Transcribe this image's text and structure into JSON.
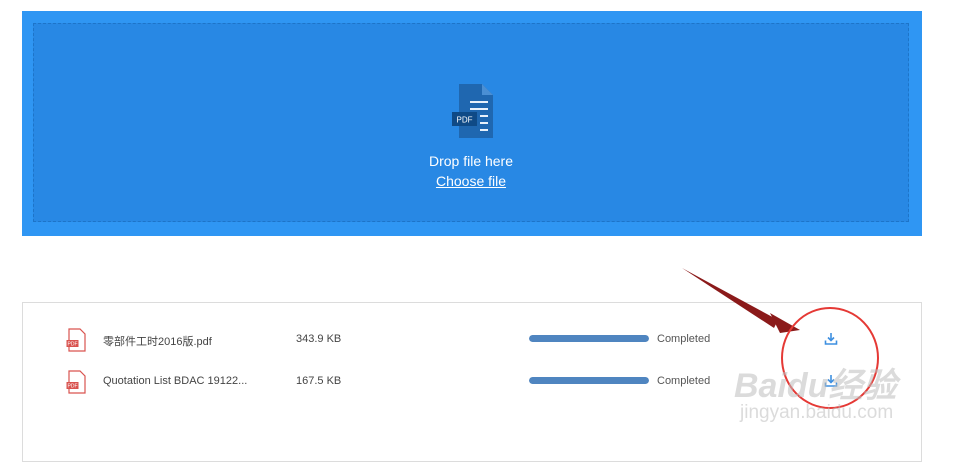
{
  "upload": {
    "drop_text": "Drop file here",
    "choose_label": "Choose file",
    "file_badge": "PDF"
  },
  "files": [
    {
      "name": "零部件工时2016版.pdf",
      "size": "343.9 KB",
      "progress": 1.0,
      "status": "Completed",
      "icon": "pdf-file-icon",
      "action_icon": "download-icon"
    },
    {
      "name": "Quotation List BDAC 19122...",
      "size": "167.5 KB",
      "progress": 1.0,
      "status": "Completed",
      "icon": "pdf-file-icon",
      "action_icon": "download-icon"
    }
  ],
  "watermark": {
    "brand": "Baidu经验",
    "url": "jingyan.baidu.com"
  },
  "colors": {
    "dropzone_outer": "#2f96f3",
    "dropzone_inner": "#2888e4",
    "progress_fill": "#4f85c0",
    "annotation_red": "#e53935",
    "arrow_dark_red": "#8b1a1a"
  }
}
